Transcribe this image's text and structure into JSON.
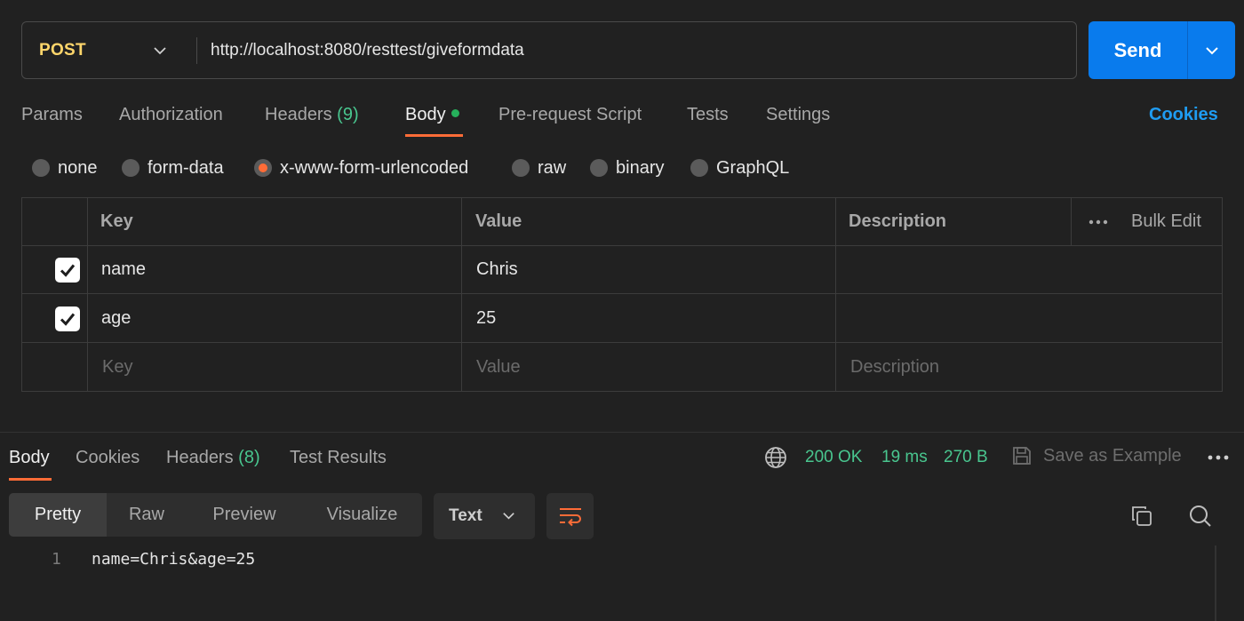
{
  "request": {
    "method": "POST",
    "url": "http://localhost:8080/resttest/giveformdata",
    "send_label": "Send"
  },
  "request_tabs": [
    {
      "label": "Params",
      "count": ""
    },
    {
      "label": "Authorization",
      "count": ""
    },
    {
      "label": "Headers",
      "count": "(9)"
    },
    {
      "label": "Body",
      "count": ""
    },
    {
      "label": "Pre-request Script",
      "count": ""
    },
    {
      "label": "Tests",
      "count": ""
    },
    {
      "label": "Settings",
      "count": ""
    }
  ],
  "active_request_tab": "Body",
  "cookies_link": "Cookies",
  "body_types": [
    "none",
    "form-data",
    "x-www-form-urlencoded",
    "raw",
    "binary",
    "GraphQL"
  ],
  "selected_body_type": "x-www-form-urlencoded",
  "kv_table": {
    "headers": {
      "key": "Key",
      "value": "Value",
      "description": "Description",
      "bulk_edit": "Bulk Edit"
    },
    "rows": [
      {
        "key": "name",
        "value": "Chris",
        "description": "",
        "checked": true
      },
      {
        "key": "age",
        "value": "25",
        "description": "",
        "checked": true
      }
    ],
    "placeholders": {
      "key": "Key",
      "value": "Value",
      "description": "Description"
    }
  },
  "response_tabs": [
    {
      "label": "Body",
      "count": ""
    },
    {
      "label": "Cookies",
      "count": ""
    },
    {
      "label": "Headers",
      "count": "(8)"
    },
    {
      "label": "Test Results",
      "count": ""
    }
  ],
  "response_status": {
    "status": "200 OK",
    "time": "19 ms",
    "size": "270 B"
  },
  "save_example_label": "Save as Example",
  "format_modes": [
    "Pretty",
    "Raw",
    "Preview",
    "Visualize"
  ],
  "active_format_mode": "Pretty",
  "text_type": "Text",
  "code_lines": [
    {
      "number": "1",
      "text": "name=Chris&age=25"
    }
  ],
  "colors": {
    "accent_orange": "#ff6c37",
    "send_blue": "#097bed",
    "method_yellow": "#ffd66b",
    "success_green": "#49c68f",
    "link_blue": "#1f9cf2"
  }
}
